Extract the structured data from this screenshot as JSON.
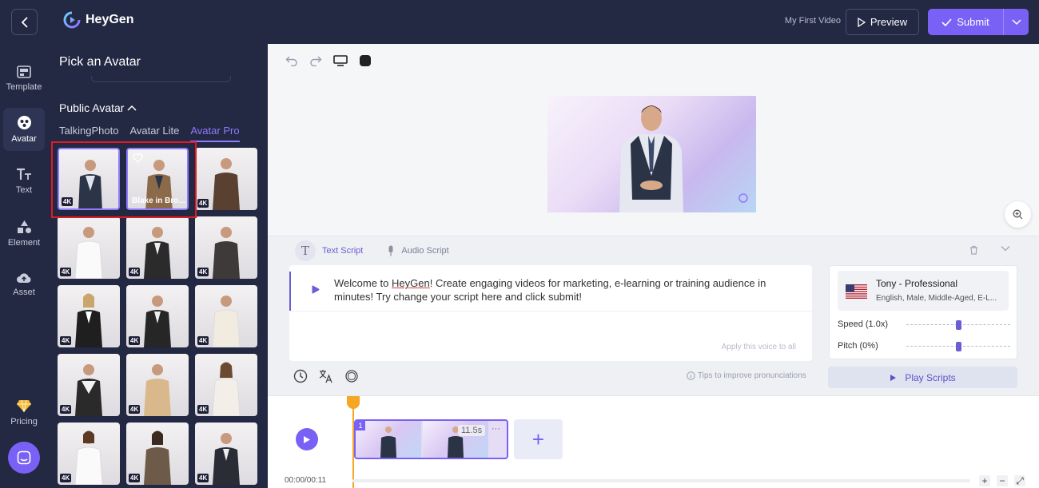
{
  "app": {
    "name": "HeyGen",
    "project_name": "My First Video"
  },
  "header": {
    "preview_label": "Preview",
    "submit_label": "Submit"
  },
  "nav": [
    {
      "label": "Template",
      "icon": "template-icon"
    },
    {
      "label": "Avatar",
      "icon": "avatar-icon"
    },
    {
      "label": "Text",
      "icon": "text-icon"
    },
    {
      "label": "Element",
      "icon": "element-icon"
    },
    {
      "label": "Asset",
      "icon": "asset-icon"
    },
    {
      "label": "Pricing",
      "icon": "diamond-icon"
    }
  ],
  "panel": {
    "title": "Pick an Avatar",
    "section_title": "Public Avatar",
    "tabs": [
      "TalkingPhoto",
      "Avatar Lite",
      "Avatar Pro"
    ],
    "active_tab": "Avatar Pro",
    "avatars": [
      {
        "badge": "4K",
        "name": ""
      },
      {
        "badge": "",
        "name": "Blake in Bro..."
      },
      {
        "badge": "4K",
        "name": ""
      },
      {
        "badge": "4K",
        "name": ""
      },
      {
        "badge": "4K",
        "name": ""
      },
      {
        "badge": "4K",
        "name": ""
      },
      {
        "badge": "4K",
        "name": ""
      },
      {
        "badge": "4K",
        "name": ""
      },
      {
        "badge": "4K",
        "name": ""
      },
      {
        "badge": "4K",
        "name": ""
      },
      {
        "badge": "4K",
        "name": ""
      },
      {
        "badge": "4K",
        "name": ""
      },
      {
        "badge": "4K",
        "name": ""
      },
      {
        "badge": "4K",
        "name": ""
      },
      {
        "badge": "4K",
        "name": ""
      }
    ]
  },
  "script": {
    "tabs": {
      "text": "Text Script",
      "audio": "Audio Script"
    },
    "text_before": "Welcome to ",
    "text_brand": "HeyGen",
    "text_after": "! Create engaging videos for marketing, e-learning or training audience in minutes! Try change your script here and click submit!",
    "apply_voice": "Apply this voice to all",
    "tips": "Tips to improve pronunciations"
  },
  "voice": {
    "name": "Tony - Professional",
    "description": "English, Male, Middle-Aged, E-L...",
    "speed_label": "Speed (1.0x)",
    "pitch_label": "Pitch (0%)",
    "speed_level": 0.5,
    "pitch_level": 0.5,
    "play_label": "Play Scripts"
  },
  "timeline": {
    "time": "00:00/00:11",
    "clip_number": "1",
    "clip_duration": "11.5s",
    "clip_more": "···",
    "add_label": "+"
  },
  "colors": {
    "accent": "#7a61f5",
    "sidebar": "#232843",
    "playhead": "#f5a623",
    "highlight": "#e11b26"
  }
}
